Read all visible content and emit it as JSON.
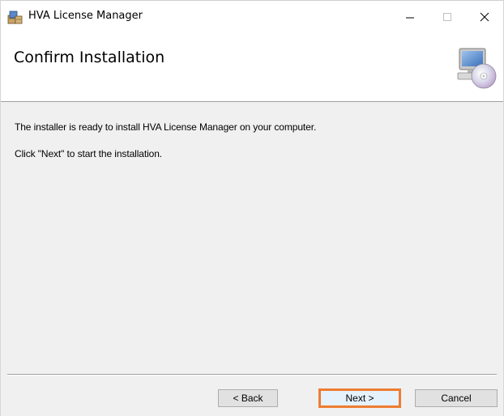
{
  "window": {
    "title": "HVA License Manager",
    "controls": {
      "minimize": "—",
      "maximize": "☐",
      "close": "✕"
    }
  },
  "banner": {
    "title": "Confirm Installation",
    "art_icon": "computer-cd-icon"
  },
  "body": {
    "line1": "The installer is ready to install HVA License Manager on your computer.",
    "line2": "Click \"Next\" to start the installation."
  },
  "buttons": {
    "back": "< Back",
    "next": "Next >",
    "cancel": "Cancel"
  },
  "colors": {
    "highlight": "#ed7d31",
    "background": "#f0f0f0",
    "banner": "#ffffff"
  }
}
